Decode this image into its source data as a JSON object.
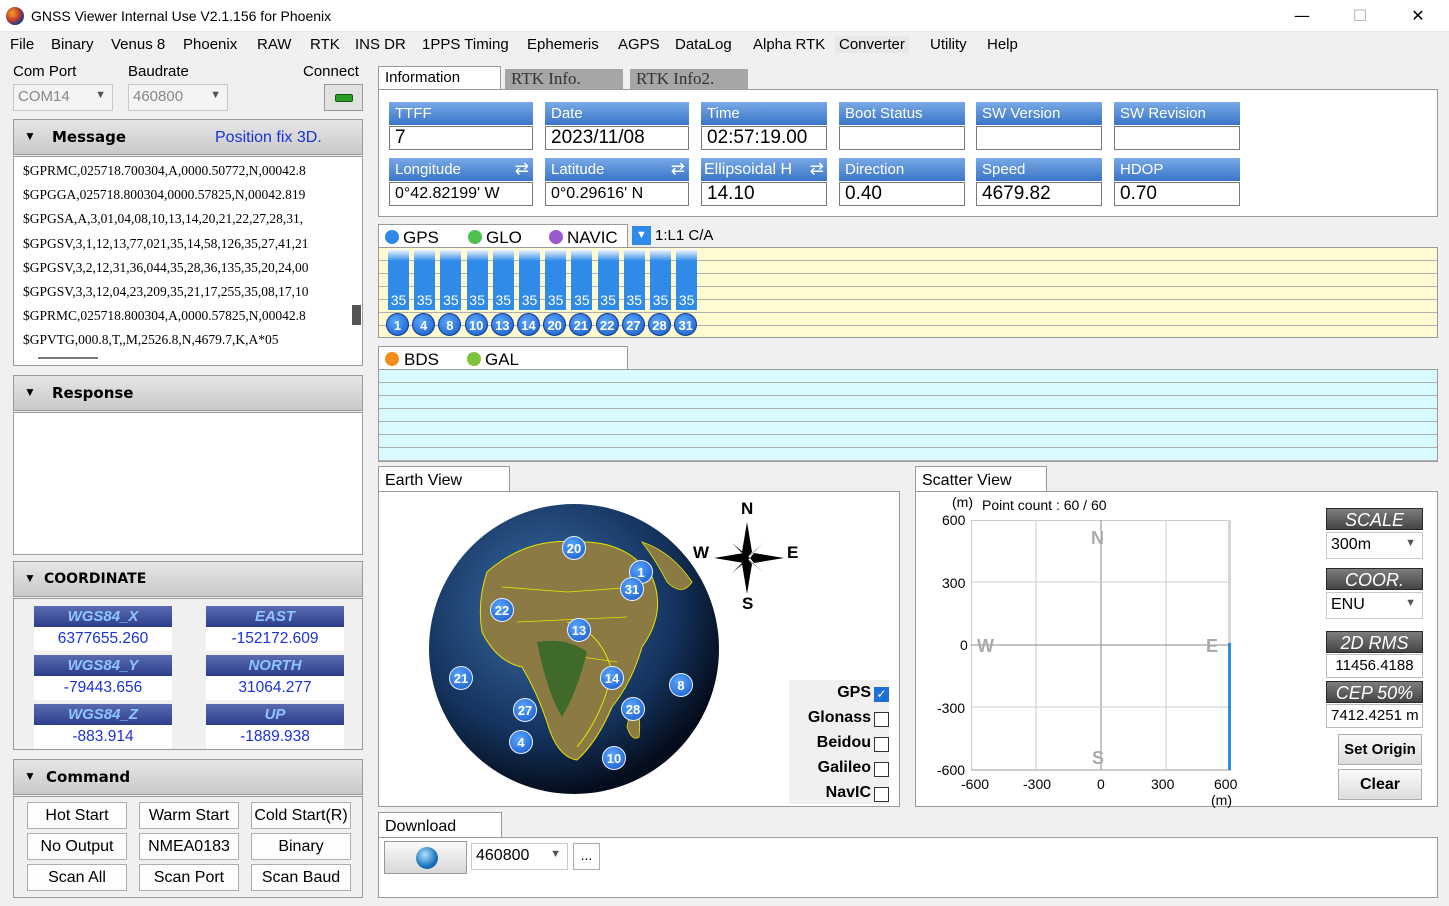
{
  "window": {
    "title": "GNSS Viewer Internal Use V2.1.156 for Phoenix",
    "minimize": "—",
    "maximize": "☐",
    "close": "✕"
  },
  "menu": [
    "File",
    "Binary",
    "Venus 8",
    "Phoenix",
    "RAW",
    "RTK",
    "INS DR",
    "1PPS Timing",
    "Ephemeris",
    "AGPS",
    "DataLog",
    "Alpha RTK",
    "Converter",
    "Utility",
    "Help"
  ],
  "connection": {
    "com_port_label": "Com Port",
    "baudrate_label": "Baudrate",
    "connect_label": "Connect",
    "com_port": "COM14",
    "baudrate": "460800"
  },
  "message_panel": {
    "title": "Message",
    "status": "Position fix 3D.",
    "lines": [
      "$GPRMC,025718.700304,A,0000.50772,N,00042.8",
      "$GPGGA,025718.800304,0000.57825,N,00042.819",
      "$GPGSA,A,3,01,04,08,10,13,14,20,21,22,27,28,31,",
      "$GPGSV,3,1,12,13,77,021,35,14,58,126,35,27,41,21",
      "$GPGSV,3,2,12,31,36,044,35,28,36,135,35,20,24,00",
      "$GPGSV,3,3,12,04,23,209,35,21,17,255,35,08,17,10",
      "$GPRMC,025718.800304,A,0000.57825,N,00042.8",
      "$GPVTG,000.8,T,,M,2526.8,N,4679.7,K,A*05"
    ]
  },
  "response_panel": {
    "title": "Response"
  },
  "coordinate_panel": {
    "title": "COORDINATE",
    "wgs84_x_label": "WGS84_X",
    "wgs84_x": "6377655.260",
    "wgs84_y_label": "WGS84_Y",
    "wgs84_y": "-79443.656",
    "wgs84_z_label": "WGS84_Z",
    "wgs84_z": "-883.914",
    "east_label": "EAST",
    "east": "-152172.609",
    "north_label": "NORTH",
    "north": "31064.277",
    "up_label": "UP",
    "up": "-1889.938"
  },
  "command_panel": {
    "title": "Command",
    "buttons": [
      "Hot Start",
      "Warm Start",
      "Cold Start(R)",
      "No Output",
      "NMEA0183",
      "Binary",
      "Scan All",
      "Scan Port",
      "Scan Baud"
    ]
  },
  "tabs": [
    "Information",
    "RTK Info.",
    "RTK Info2."
  ],
  "info": {
    "ttff_label": "TTFF",
    "ttff": "7",
    "date_label": "Date",
    "date": "2023/11/08",
    "time_label": "Time",
    "time": "02:57:19.00",
    "boot_label": "Boot  Status",
    "boot": "",
    "sw_version_label": "SW  Version",
    "sw_version": "",
    "sw_revision_label": "SW  Revision",
    "sw_revision": "",
    "longitude_label": "Longitude",
    "longitude": "0°42.82199' W",
    "latitude_label": "Latitude",
    "latitude": "0°0.29616' N",
    "ellipsoidal_label": "Ellipsoidal H",
    "ellipsoidal": "14.10",
    "direction_label": "Direction",
    "direction": "0.40",
    "speed_label": "Speed",
    "speed": "4679.82",
    "hdop_label": "HDOP",
    "hdop": "0.70"
  },
  "gps_panel": {
    "legend": [
      "GPS",
      "GLO",
      "NAVIC"
    ],
    "signal": "1:L1 C/A",
    "satellites": [
      {
        "prn": "1",
        "snr": "35"
      },
      {
        "prn": "4",
        "snr": "35"
      },
      {
        "prn": "8",
        "snr": "35"
      },
      {
        "prn": "10",
        "snr": "35"
      },
      {
        "prn": "13",
        "snr": "35"
      },
      {
        "prn": "14",
        "snr": "35"
      },
      {
        "prn": "20",
        "snr": "35"
      },
      {
        "prn": "21",
        "snr": "35"
      },
      {
        "prn": "22",
        "snr": "35"
      },
      {
        "prn": "27",
        "snr": "35"
      },
      {
        "prn": "28",
        "snr": "35"
      },
      {
        "prn": "31",
        "snr": "35"
      }
    ]
  },
  "bds_panel": {
    "legend": [
      "BDS",
      "GAL"
    ]
  },
  "earth_view": {
    "title": "Earth View",
    "compass": {
      "n": "N",
      "s": "S",
      "e": "E",
      "w": "W"
    },
    "satellites": [
      "20",
      "1",
      "31",
      "22",
      "13",
      "21",
      "14",
      "8",
      "27",
      "28",
      "4",
      "10"
    ],
    "constellations": [
      {
        "name": "GPS",
        "checked": true
      },
      {
        "name": "Glonass",
        "checked": false
      },
      {
        "name": "Beidou",
        "checked": false
      },
      {
        "name": "Galileo",
        "checked": false
      },
      {
        "name": "NavIC",
        "checked": false
      }
    ]
  },
  "scatter_view": {
    "title": "Scatter View",
    "unit": "(m)",
    "point_count": "Point count : 60 / 60",
    "y_ticks": [
      "600",
      "300",
      "0",
      "-300",
      "-600"
    ],
    "x_ticks": [
      "-600",
      "-300",
      "0",
      "300",
      "600"
    ],
    "dir": {
      "n": "N",
      "s": "S",
      "e": "E",
      "w": "W"
    },
    "scale_label": "SCALE",
    "scale": "300m",
    "coor_label": "COOR.",
    "coor": "ENU",
    "rms_label": "2D RMS",
    "rms": "11456.4188",
    "cep_label": "CEP 50%",
    "cep": "7412.4251 m",
    "set_origin": "Set Origin",
    "clear": "Clear"
  },
  "download": {
    "title": "Download",
    "baud": "460800",
    "browse": "..."
  },
  "colors": {
    "gps": "#2f8ae8",
    "glo": "#4cc24c",
    "navic": "#9b59d0",
    "bds": "#f28c1a",
    "gal": "#7cc23a",
    "gps_bg": "#fffad0",
    "bds_bg": "#d9fbff"
  }
}
